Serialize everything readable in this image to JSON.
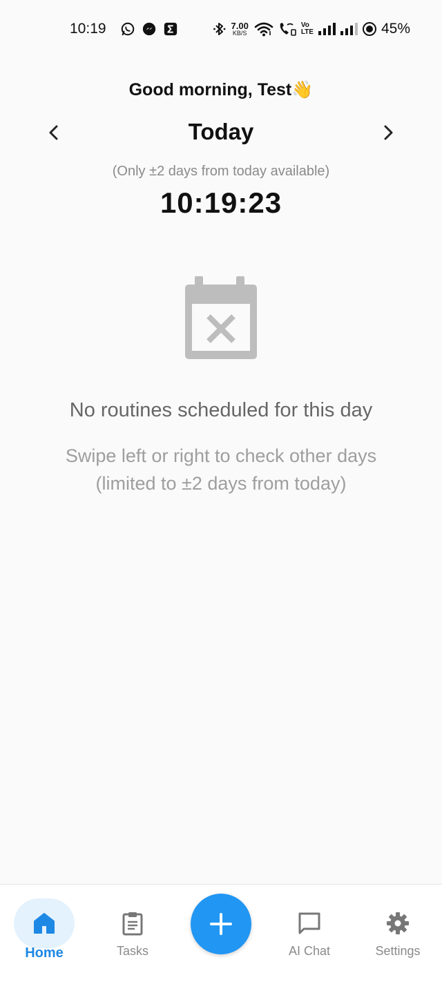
{
  "status_bar": {
    "time": "10:19",
    "net_speed_value": "7.00",
    "net_speed_unit": "KB/S",
    "volte_line1": "Vo",
    "volte_line2": "LTE",
    "battery_percent": "45%",
    "notification_icons": [
      "whatsapp-icon",
      "messenger-icon",
      "sigma-app-icon"
    ],
    "status_icons": [
      "bluetooth-icon",
      "wifi-icon",
      "wifi-calling-icon",
      "signal-icon",
      "signal-icon",
      "battery-saver-icon"
    ]
  },
  "header": {
    "greeting": "Good morning, Test👋",
    "day_title": "Today",
    "range_note": "(Only ±2 days from today available)",
    "clock": "10:19:23"
  },
  "empty_state": {
    "icon": "calendar-x-icon",
    "title": "No routines scheduled for this day",
    "hint_line1": "Swipe left or right to check other days",
    "hint_line2": "(limited to ±2 days from today)"
  },
  "bottom_nav": {
    "active": "home",
    "items": [
      {
        "id": "home",
        "label": "Home",
        "icon": "home-icon"
      },
      {
        "id": "tasks",
        "label": "Tasks",
        "icon": "clipboard-icon"
      },
      {
        "id": "add",
        "label": "",
        "icon": "plus-icon"
      },
      {
        "id": "chat",
        "label": "AI Chat",
        "icon": "chat-bubble-icon"
      },
      {
        "id": "settings",
        "label": "Settings",
        "icon": "gear-icon"
      }
    ]
  },
  "colors": {
    "accent": "#2196f3",
    "accent_light": "#e3f2fd",
    "background": "#fafafa",
    "muted_text": "#9e9e9e",
    "empty_icon": "#bdbdbd"
  }
}
